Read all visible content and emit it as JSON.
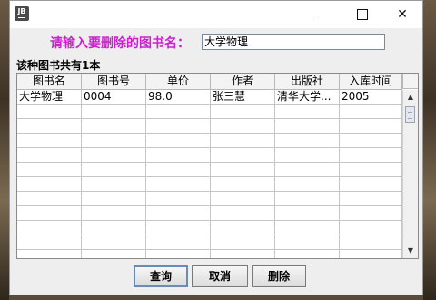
{
  "window": {
    "icon_text": "JB",
    "minimize_glyph": "",
    "close_glyph": "✕"
  },
  "form": {
    "prompt_label": "请输入要删除的图书名：",
    "book_name_value": "大学物理"
  },
  "result": {
    "count_text": "该种图书共有1本"
  },
  "table": {
    "columns": [
      "图书名",
      "图书号",
      "单价",
      "作者",
      "出版社",
      "入库时间"
    ],
    "rows": [
      [
        "大学物理",
        "0004",
        "98.0",
        "张三慧",
        "清华大学...",
        "2005"
      ]
    ]
  },
  "buttons": {
    "query": "查询",
    "cancel": "取消",
    "delete": "删除"
  },
  "scrollbar": {
    "up_glyph": "▲",
    "down_glyph": "▼"
  }
}
